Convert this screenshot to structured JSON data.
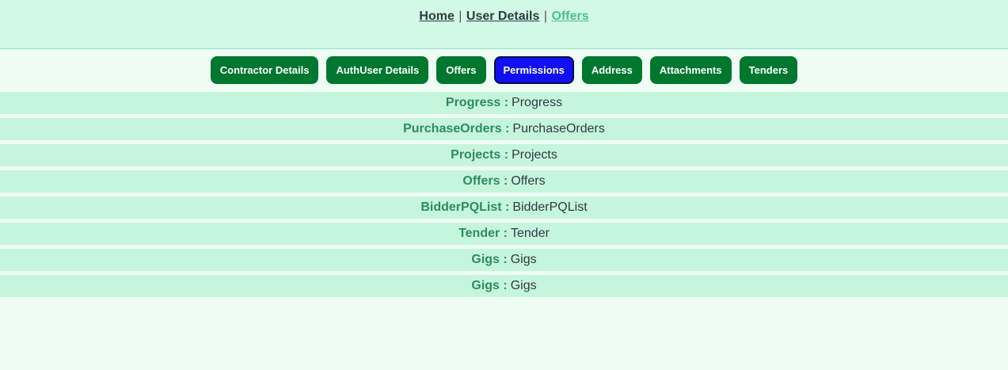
{
  "breadcrumb": {
    "items": [
      {
        "label": "Home"
      },
      {
        "label": "User Details"
      },
      {
        "label": "Offers"
      }
    ],
    "separator": "|"
  },
  "tabs": [
    {
      "label": "Contractor Details"
    },
    {
      "label": "AuthUser Details"
    },
    {
      "label": "Offers"
    },
    {
      "label": "Permissions"
    },
    {
      "label": "Address"
    },
    {
      "label": "Attachments"
    },
    {
      "label": "Tenders"
    }
  ],
  "active_tab": "Permissions",
  "permissions": [
    {
      "label": "Progress :",
      "value": "Progress"
    },
    {
      "label": "PurchaseOrders :",
      "value": "PurchaseOrders"
    },
    {
      "label": "Projects :",
      "value": "Projects"
    },
    {
      "label": "Offers :",
      "value": "Offers"
    },
    {
      "label": "BidderPQList :",
      "value": "BidderPQList"
    },
    {
      "label": "Tender :",
      "value": "Tender"
    },
    {
      "label": "Gigs :",
      "value": "Gigs"
    },
    {
      "label": "Gigs :",
      "value": "Gigs"
    }
  ],
  "colors": {
    "header_bg": "#d2f9e8",
    "page_bg": "#eefcf4",
    "tab_bg": "#00772f",
    "tab_active_bg": "#1010f0",
    "row_bg": "#c6f5de",
    "label_color": "#2e8b5e",
    "breadcrumb_active": "#4fbf8c"
  }
}
